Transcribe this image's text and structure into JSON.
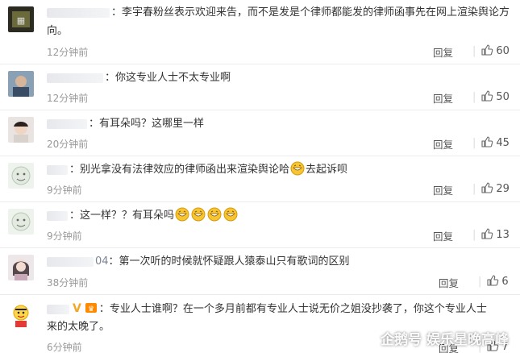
{
  "comments": [
    {
      "user_suffix": "",
      "text_line1": "：李宇春粉丝表示欢迎来告，而不是发是个律师都能发的律师函事先在网上渲染舆论方",
      "text_line2": "向。",
      "time": "12分钟前",
      "reply": "回复",
      "likes": "60"
    },
    {
      "user_suffix": "",
      "text_line1": "：你这专业人士不太专业啊",
      "time": "12分钟前",
      "reply": "回复",
      "likes": "50"
    },
    {
      "user_suffix": "",
      "text_line1": "：有耳朵吗？这哪里一样",
      "time": "20分钟前",
      "reply": "回复",
      "likes": "45"
    },
    {
      "user_suffix": "",
      "text_line1a": "：别光拿没有法律效应的律师函出来渲染舆论哈",
      "text_line1b": "去起诉呗",
      "time": "9分钟前",
      "reply": "回复",
      "likes": "29"
    },
    {
      "user_suffix": "",
      "text_line1": "：这一样？？有耳朵吗",
      "time": "9分钟前",
      "reply": "回复",
      "likes": "13"
    },
    {
      "user_suffix": "04",
      "text_line1": "：第一次听的时候就怀疑跟人猿泰山只有歌词的区别",
      "time": "38分钟前",
      "reply": "回复",
      "likes": "6"
    },
    {
      "user_suffix": "V",
      "text_line1": "：专业人士谁啊？在一个多月前都有专业人士说无价之姐没抄袭了，你这个专业人士",
      "text_line2": "来的太晚了。",
      "time": "6分钟前",
      "reply": "回复",
      "likes": "7"
    }
  ],
  "watermark": "企鹅号 娱乐星晚高峰",
  "icons": {
    "like": "thumbs-up-icon",
    "emoji": "grin-emoji-icon"
  },
  "colors": {
    "text": "#333333",
    "meta": "#999999",
    "divider": "#ececec"
  }
}
